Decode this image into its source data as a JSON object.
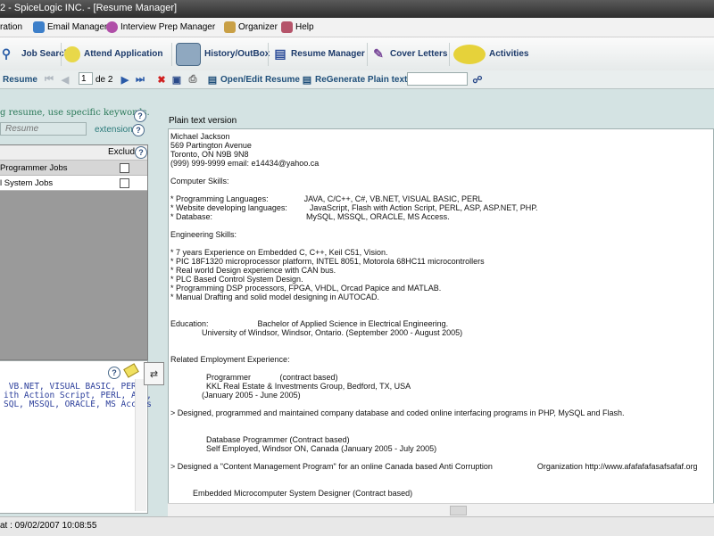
{
  "window": {
    "title": "2 - SpiceLogic INC. - [Resume Manager]"
  },
  "menu": {
    "items": [
      {
        "label": "ration"
      },
      {
        "label": "Email Manager"
      },
      {
        "label": "Interview Prep Manager"
      },
      {
        "label": "Organizer"
      },
      {
        "label": "Help"
      }
    ]
  },
  "toolbar": {
    "buttons": [
      {
        "label": "Job Search"
      },
      {
        "label": "Attend Application"
      },
      {
        "label": "History/OutBox"
      },
      {
        "label": "Resume Manager"
      },
      {
        "label": "Cover Letters"
      },
      {
        "label": "Activities"
      }
    ]
  },
  "nav": {
    "resume_label": "Resume",
    "page_value": "1",
    "page_total": "de 2",
    "open_edit_label": "Open/Edit Resume",
    "regenerate_label": "ReGenerate Plain text",
    "search_value": ""
  },
  "left": {
    "hint": "g resume, use specific keywords.",
    "keyword_placeholder": "Resume",
    "extension_label": "extension",
    "grid": {
      "exclude_header": "Exclude",
      "rows": [
        {
          "label": "Programmer Jobs",
          "selected": true
        },
        {
          "label": "l System Jobs",
          "selected": false
        }
      ]
    },
    "skills_text": " VB.NET, VISUAL BASIC, PERL,\nith Action Script, PERL, ASP,\nSQL, MSSQL, ORACLE, MS Access"
  },
  "plaintext": {
    "label": "Plain text version",
    "body": "Michael Jackson\n569 Partington Avenue\nToronto, ON N9B 9N8\n(999) 999-9999 email: e14434@yahoo.ca\n\nComputer Skills:\n\n* Programming Languages:                JAVA, C/C++, C#, VB.NET, VISUAL BASIC, PERL\n* Website developing languages:          JavaScript, Flash with Action Script, PERL, ASP, ASP.NET, PHP.\n* Database:                                          MySQL, MSSQL, ORACLE, MS Access.\n\nEngineering Skills:\n\n* 7 years Experience on Embedded C, C++, Keil C51, Vision.\n* PIC 18F1320 microprocessor platform, INTEL 8051, Motorola 68HC11 microcontrollers\n* Real world Design experience with CAN bus.\n* PLC Based Control System Design.\n* Programming DSP processors, FPGA, VHDL, Orcad Papice and MATLAB.\n* Manual Drafting and solid model designing in AUTOCAD.\n\n\nEducation:                      Bachelor of Applied Science in Electrical Engineering.\n              University of Windsor, Windsor, Ontario. (September 2000 - August 2005)\n\n\nRelated Employment Experience:\n\n                Programmer             (contract based)\n                KKL Real Estate & Investments Group, Bedford, TX, USA\n              (January 2005 - June 2005)\n\n> Designed, programmed and maintained company database and coded online interfacing programs in PHP, MySQL and Flash.\n\n\n                Database Programmer (Contract based)\n                Self Employed, Windsor ON, Canada (January 2005 - July 2005)\n\n> Designed a \"Content Management Program\" for an online Canada based Anti Corruption                    Organization http://www.afafafafasafsafaf.org\n\n\n          Embedded Microcomputer System Designer (Contract based)"
  },
  "status": {
    "text": "at : 09/02/2007 10:08:55"
  }
}
